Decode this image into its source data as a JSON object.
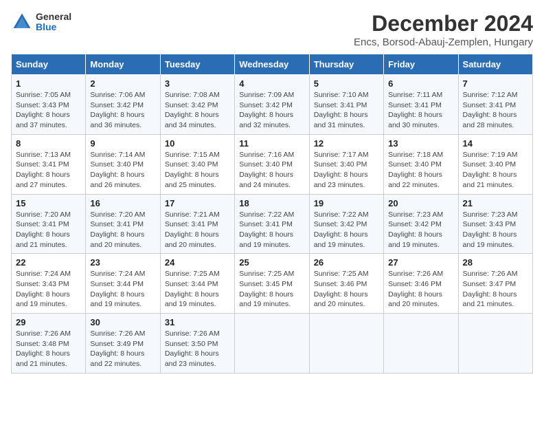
{
  "logo": {
    "general": "General",
    "blue": "Blue"
  },
  "title": "December 2024",
  "subtitle": "Encs, Borsod-Abauj-Zemplen, Hungary",
  "days_of_week": [
    "Sunday",
    "Monday",
    "Tuesday",
    "Wednesday",
    "Thursday",
    "Friday",
    "Saturday"
  ],
  "weeks": [
    [
      {
        "day": "1",
        "sunrise": "Sunrise: 7:05 AM",
        "sunset": "Sunset: 3:43 PM",
        "daylight": "Daylight: 8 hours and 37 minutes."
      },
      {
        "day": "2",
        "sunrise": "Sunrise: 7:06 AM",
        "sunset": "Sunset: 3:42 PM",
        "daylight": "Daylight: 8 hours and 36 minutes."
      },
      {
        "day": "3",
        "sunrise": "Sunrise: 7:08 AM",
        "sunset": "Sunset: 3:42 PM",
        "daylight": "Daylight: 8 hours and 34 minutes."
      },
      {
        "day": "4",
        "sunrise": "Sunrise: 7:09 AM",
        "sunset": "Sunset: 3:42 PM",
        "daylight": "Daylight: 8 hours and 32 minutes."
      },
      {
        "day": "5",
        "sunrise": "Sunrise: 7:10 AM",
        "sunset": "Sunset: 3:41 PM",
        "daylight": "Daylight: 8 hours and 31 minutes."
      },
      {
        "day": "6",
        "sunrise": "Sunrise: 7:11 AM",
        "sunset": "Sunset: 3:41 PM",
        "daylight": "Daylight: 8 hours and 30 minutes."
      },
      {
        "day": "7",
        "sunrise": "Sunrise: 7:12 AM",
        "sunset": "Sunset: 3:41 PM",
        "daylight": "Daylight: 8 hours and 28 minutes."
      }
    ],
    [
      {
        "day": "8",
        "sunrise": "Sunrise: 7:13 AM",
        "sunset": "Sunset: 3:41 PM",
        "daylight": "Daylight: 8 hours and 27 minutes."
      },
      {
        "day": "9",
        "sunrise": "Sunrise: 7:14 AM",
        "sunset": "Sunset: 3:40 PM",
        "daylight": "Daylight: 8 hours and 26 minutes."
      },
      {
        "day": "10",
        "sunrise": "Sunrise: 7:15 AM",
        "sunset": "Sunset: 3:40 PM",
        "daylight": "Daylight: 8 hours and 25 minutes."
      },
      {
        "day": "11",
        "sunrise": "Sunrise: 7:16 AM",
        "sunset": "Sunset: 3:40 PM",
        "daylight": "Daylight: 8 hours and 24 minutes."
      },
      {
        "day": "12",
        "sunrise": "Sunrise: 7:17 AM",
        "sunset": "Sunset: 3:40 PM",
        "daylight": "Daylight: 8 hours and 23 minutes."
      },
      {
        "day": "13",
        "sunrise": "Sunrise: 7:18 AM",
        "sunset": "Sunset: 3:40 PM",
        "daylight": "Daylight: 8 hours and 22 minutes."
      },
      {
        "day": "14",
        "sunrise": "Sunrise: 7:19 AM",
        "sunset": "Sunset: 3:40 PM",
        "daylight": "Daylight: 8 hours and 21 minutes."
      }
    ],
    [
      {
        "day": "15",
        "sunrise": "Sunrise: 7:20 AM",
        "sunset": "Sunset: 3:41 PM",
        "daylight": "Daylight: 8 hours and 21 minutes."
      },
      {
        "day": "16",
        "sunrise": "Sunrise: 7:20 AM",
        "sunset": "Sunset: 3:41 PM",
        "daylight": "Daylight: 8 hours and 20 minutes."
      },
      {
        "day": "17",
        "sunrise": "Sunrise: 7:21 AM",
        "sunset": "Sunset: 3:41 PM",
        "daylight": "Daylight: 8 hours and 20 minutes."
      },
      {
        "day": "18",
        "sunrise": "Sunrise: 7:22 AM",
        "sunset": "Sunset: 3:41 PM",
        "daylight": "Daylight: 8 hours and 19 minutes."
      },
      {
        "day": "19",
        "sunrise": "Sunrise: 7:22 AM",
        "sunset": "Sunset: 3:42 PM",
        "daylight": "Daylight: 8 hours and 19 minutes."
      },
      {
        "day": "20",
        "sunrise": "Sunrise: 7:23 AM",
        "sunset": "Sunset: 3:42 PM",
        "daylight": "Daylight: 8 hours and 19 minutes."
      },
      {
        "day": "21",
        "sunrise": "Sunrise: 7:23 AM",
        "sunset": "Sunset: 3:43 PM",
        "daylight": "Daylight: 8 hours and 19 minutes."
      }
    ],
    [
      {
        "day": "22",
        "sunrise": "Sunrise: 7:24 AM",
        "sunset": "Sunset: 3:43 PM",
        "daylight": "Daylight: 8 hours and 19 minutes."
      },
      {
        "day": "23",
        "sunrise": "Sunrise: 7:24 AM",
        "sunset": "Sunset: 3:44 PM",
        "daylight": "Daylight: 8 hours and 19 minutes."
      },
      {
        "day": "24",
        "sunrise": "Sunrise: 7:25 AM",
        "sunset": "Sunset: 3:44 PM",
        "daylight": "Daylight: 8 hours and 19 minutes."
      },
      {
        "day": "25",
        "sunrise": "Sunrise: 7:25 AM",
        "sunset": "Sunset: 3:45 PM",
        "daylight": "Daylight: 8 hours and 19 minutes."
      },
      {
        "day": "26",
        "sunrise": "Sunrise: 7:25 AM",
        "sunset": "Sunset: 3:46 PM",
        "daylight": "Daylight: 8 hours and 20 minutes."
      },
      {
        "day": "27",
        "sunrise": "Sunrise: 7:26 AM",
        "sunset": "Sunset: 3:46 PM",
        "daylight": "Daylight: 8 hours and 20 minutes."
      },
      {
        "day": "28",
        "sunrise": "Sunrise: 7:26 AM",
        "sunset": "Sunset: 3:47 PM",
        "daylight": "Daylight: 8 hours and 21 minutes."
      }
    ],
    [
      {
        "day": "29",
        "sunrise": "Sunrise: 7:26 AM",
        "sunset": "Sunset: 3:48 PM",
        "daylight": "Daylight: 8 hours and 21 minutes."
      },
      {
        "day": "30",
        "sunrise": "Sunrise: 7:26 AM",
        "sunset": "Sunset: 3:49 PM",
        "daylight": "Daylight: 8 hours and 22 minutes."
      },
      {
        "day": "31",
        "sunrise": "Sunrise: 7:26 AM",
        "sunset": "Sunset: 3:50 PM",
        "daylight": "Daylight: 8 hours and 23 minutes."
      },
      null,
      null,
      null,
      null
    ]
  ]
}
